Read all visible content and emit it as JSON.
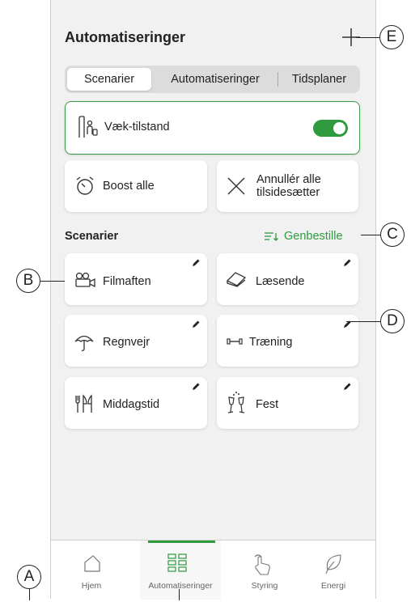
{
  "header": {
    "title": "Automatiseringer",
    "add_icon": "plus-icon"
  },
  "segments": [
    "Scenarier",
    "Automatiseringer",
    "Tidsplaner"
  ],
  "away_card": {
    "label": "Væk-tilstand",
    "toggle_on": true,
    "icon": "away-person-icon"
  },
  "actions": {
    "boost": "Boost alle",
    "cancel_line1": "Annullér alle",
    "cancel_line2": "tilsidesætter"
  },
  "section": {
    "title": "Scenarier",
    "reorder": "Genbestille"
  },
  "scenarios": [
    {
      "label": "Filmaften",
      "icon": "movie-camera-icon"
    },
    {
      "label": "Læsende",
      "icon": "book-icon"
    },
    {
      "label": "Regnvejr",
      "icon": "umbrella-icon"
    },
    {
      "label": "Træning",
      "icon": "dumbbell-icon"
    },
    {
      "label": "Middagstid",
      "icon": "cutlery-icon"
    },
    {
      "label": "Fest",
      "icon": "champagne-icon"
    }
  ],
  "tabs": [
    {
      "label": "Hjem",
      "icon": "home-icon"
    },
    {
      "label": "Automatiseringer",
      "icon": "grid-icon",
      "active": true
    },
    {
      "label": "Styring",
      "icon": "touch-hand-icon"
    },
    {
      "label": "Energi",
      "icon": "leaf-icon"
    }
  ],
  "callouts": {
    "a": "A",
    "b": "B",
    "c": "C",
    "d": "D",
    "e": "E"
  },
  "colors": {
    "accent": "#2f9a3e",
    "background": "#f1f1f1"
  }
}
